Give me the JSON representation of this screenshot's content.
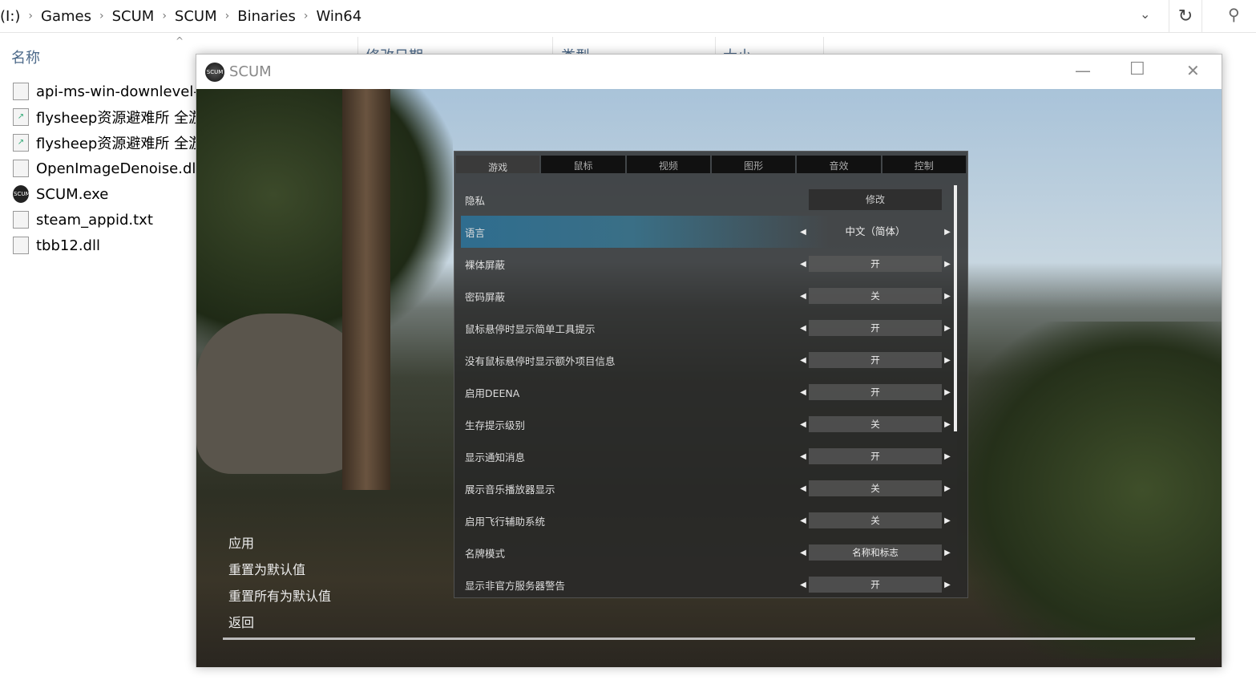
{
  "explorer": {
    "breadcrumb": [
      "(I:)",
      "Games",
      "SCUM",
      "SCUM",
      "Binaries",
      "Win64"
    ],
    "columns": {
      "name": "名称",
      "date": "修改日期",
      "type": "类型",
      "size": "大小"
    },
    "files": [
      {
        "name": "api-ms-win-downlevel-",
        "icon": "dll-file-icon"
      },
      {
        "name": "flysheep资源避难所 全游",
        "icon": "shortcut-icon"
      },
      {
        "name": "flysheep资源避难所 全游",
        "icon": "shortcut-icon"
      },
      {
        "name": "OpenImageDenoise.dll",
        "icon": "dll-file-icon"
      },
      {
        "name": "SCUM.exe",
        "icon": "scum-app-icon"
      },
      {
        "name": "steam_appid.txt",
        "icon": "text-file-icon"
      },
      {
        "name": "tbb12.dll",
        "icon": "dll-file-icon"
      }
    ]
  },
  "window": {
    "title": "SCUM",
    "logo_text": "SCUM"
  },
  "settings": {
    "tabs": [
      "游戏",
      "鼠标",
      "视频",
      "图形",
      "音效",
      "控制"
    ],
    "active_tab": 0,
    "rows": [
      {
        "label": "隐私",
        "value": "修改",
        "type": "button"
      },
      {
        "label": "语言",
        "value": "中文（简体）",
        "selected": true
      },
      {
        "label": "裸体屏蔽",
        "value": "开"
      },
      {
        "label": "密码屏蔽",
        "value": "关"
      },
      {
        "label": "鼠标悬停时显示简单工具提示",
        "value": "开"
      },
      {
        "label": "没有鼠标悬停时显示额外项目信息",
        "value": "开"
      },
      {
        "label": "启用DEENA",
        "value": "开"
      },
      {
        "label": "生存提示级别",
        "value": "关"
      },
      {
        "label": "显示通知消息",
        "value": "开"
      },
      {
        "label": "展示音乐播放器显示",
        "value": "关"
      },
      {
        "label": "启用飞行辅助系统",
        "value": "关"
      },
      {
        "label": "名牌模式",
        "value": "名称和标志"
      },
      {
        "label": "显示非官方服务器警告",
        "value": "开"
      }
    ]
  },
  "menu": [
    "应用",
    "重置为默认值",
    "重置所有为默认值",
    "返回"
  ]
}
